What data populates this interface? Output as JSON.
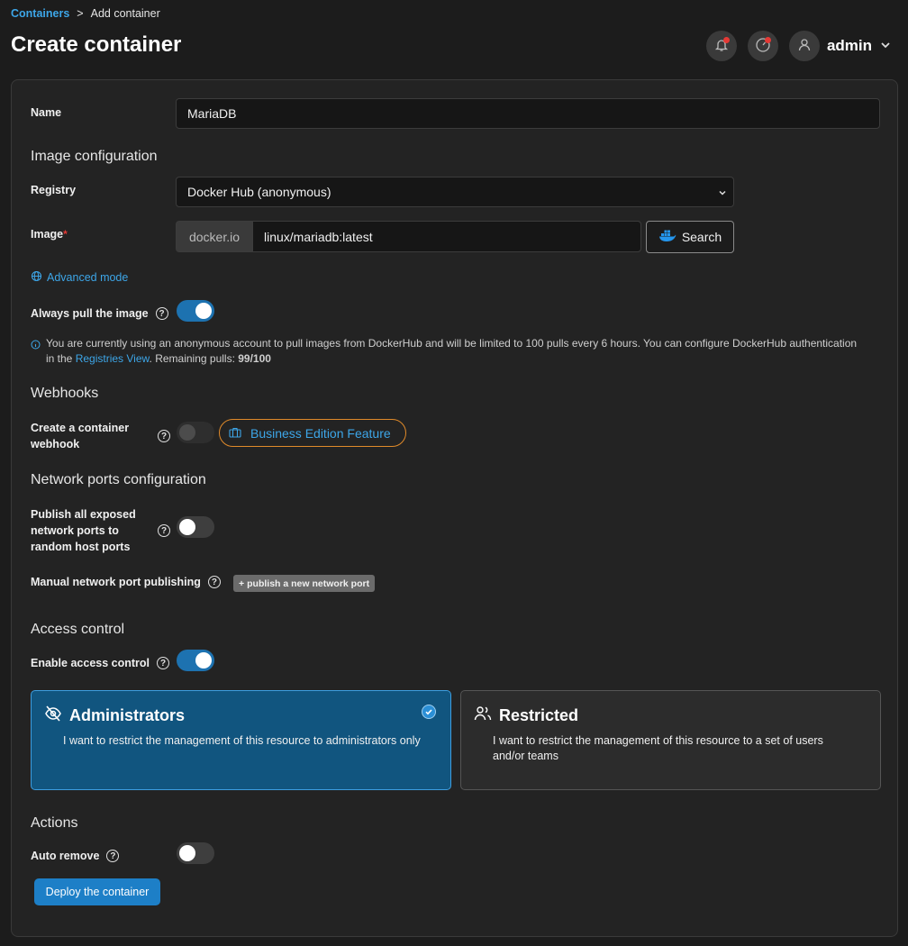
{
  "breadcrumb": {
    "parent": "Containers",
    "separator": ">",
    "current": "Add container"
  },
  "page_title": "Create container",
  "user": {
    "name": "admin"
  },
  "form": {
    "name_label": "Name",
    "name_value": "MariaDB",
    "image_section": "Image configuration",
    "registry_label": "Registry",
    "registry_value": "Docker Hub (anonymous)",
    "image_label": "Image",
    "image_required": "*",
    "image_prefix": "docker.io",
    "image_value": "linux/mariadb:latest",
    "search_label": "Search",
    "advanced_mode": "Advanced mode",
    "always_pull_label": "Always pull the image",
    "always_pull": true,
    "info_text_1": "You are currently using an anonymous account to pull images from DockerHub and will be limited to 100 pulls every 6 hours. You can configure DockerHub authentication in the ",
    "info_link": "Registries View",
    "info_text_2": ". Remaining pulls: ",
    "info_remaining": "99/100",
    "webhooks_section": "Webhooks",
    "webhook_label_1": "Create a container",
    "webhook_label_2": "webhook",
    "business_badge": "Business Edition Feature",
    "network_section": "Network ports configuration",
    "publish_label_1": "Publish all exposed",
    "publish_label_2": "network ports to",
    "publish_label_3": "random host ports",
    "publish_all": false,
    "manual_label": "Manual network port publishing",
    "publish_port_btn": "publish a new network port",
    "access_section": "Access control",
    "enable_access_label": "Enable access control",
    "enable_access": true,
    "admin_card_title": "Administrators",
    "admin_card_desc": "I want to restrict the management of this resource to administrators only",
    "restricted_card_title": "Restricted",
    "restricted_card_desc_1": "I want to restrict the management of this resource to a set of users",
    "restricted_card_desc_2": "and/or teams",
    "actions_section": "Actions",
    "auto_remove_label": "Auto remove",
    "auto_remove": false,
    "deploy_label": "Deploy the container"
  },
  "colors": {
    "accent": "#1d72b0",
    "link": "#3da6e8",
    "badge_border": "#e08a2a",
    "notification": "#e53935"
  },
  "icons": [
    "bell-icon",
    "gauge-icon",
    "user-icon",
    "chevron-down-icon",
    "docker-icon",
    "globe-icon",
    "help-icon",
    "info-icon",
    "briefcase-icon",
    "plus-icon",
    "eye-off-icon",
    "users-icon",
    "check-icon"
  ]
}
